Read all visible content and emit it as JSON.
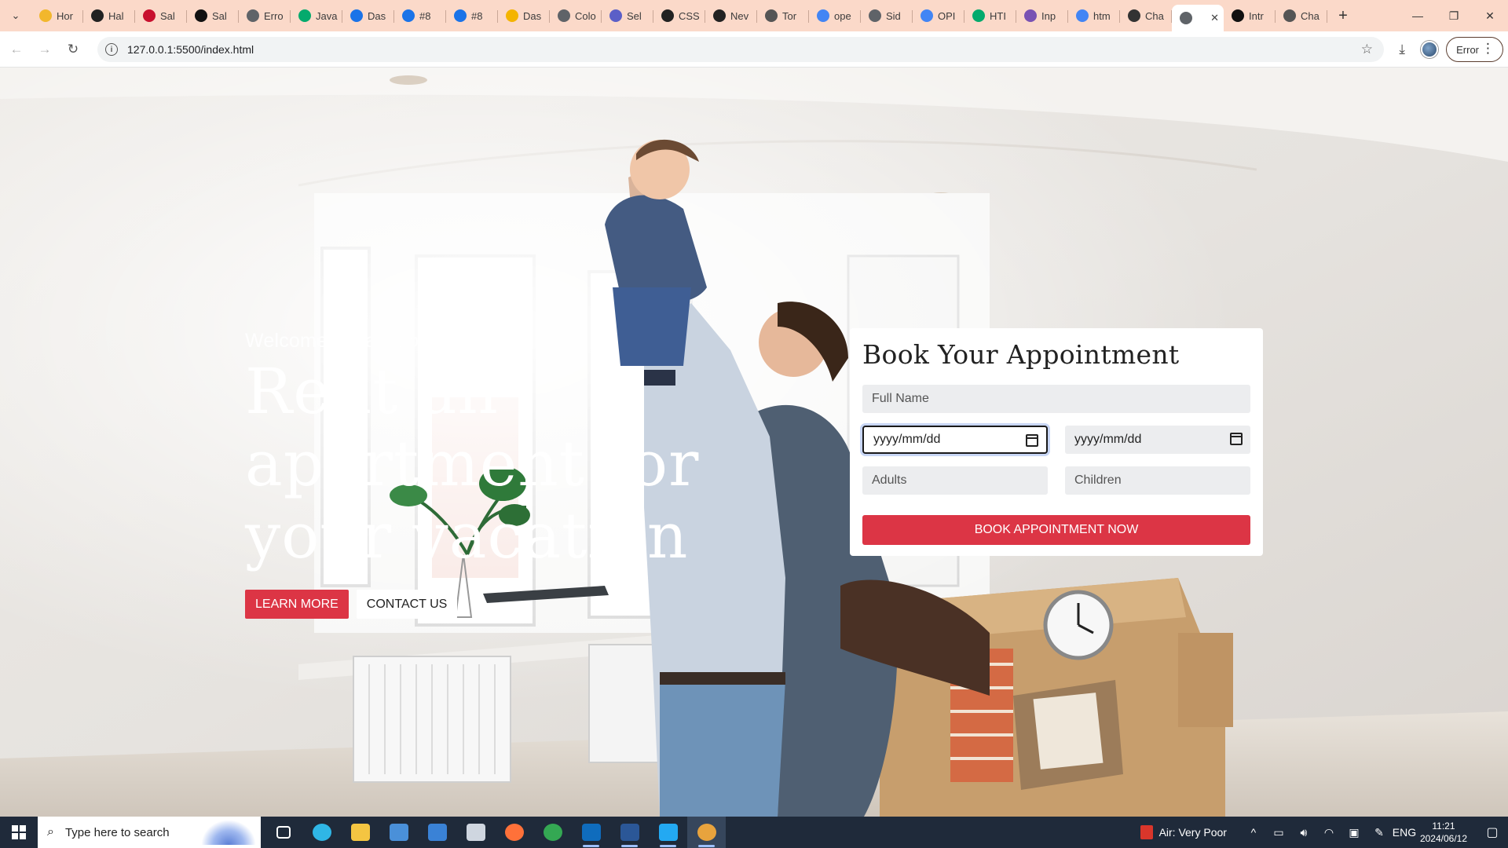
{
  "browser": {
    "tabs": [
      {
        "label": "Hor",
        "icon": "drive-icon",
        "color": "#f2b72c"
      },
      {
        "label": "Hal",
        "icon": "openai-icon",
        "color": "#222222"
      },
      {
        "label": "Sal",
        "icon": "sales-icon",
        "color": "#c8102e"
      },
      {
        "label": "Sal",
        "icon": "k-icon",
        "color": "#111111"
      },
      {
        "label": "Erro",
        "icon": "globe-icon",
        "color": "#5f6368"
      },
      {
        "label": "Java",
        "icon": "w3-icon",
        "color": "#04aa6d"
      },
      {
        "label": "Das",
        "icon": "bookmark-icon",
        "color": "#1a73e8"
      },
      {
        "label": "#8",
        "icon": "bookmark-icon",
        "color": "#1a73e8"
      },
      {
        "label": "#8",
        "icon": "bookmark-icon",
        "color": "#1a73e8"
      },
      {
        "label": "Das",
        "icon": "folder-icon",
        "color": "#f4b400"
      },
      {
        "label": "Colo",
        "icon": "globe-icon",
        "color": "#5f6368"
      },
      {
        "label": "Sel",
        "icon": "teams-icon",
        "color": "#5b5fc7"
      },
      {
        "label": "CSS",
        "icon": "github-icon",
        "color": "#222222"
      },
      {
        "label": "Nev",
        "icon": "openai-icon",
        "color": "#222222"
      },
      {
        "label": "Tor",
        "icon": "flame-icon",
        "color": "#555555"
      },
      {
        "label": "ope",
        "icon": "google-icon",
        "color": "#4285f4"
      },
      {
        "label": "Sid",
        "icon": "globe-icon",
        "color": "#5f6368"
      },
      {
        "label": "OPI",
        "icon": "google-icon",
        "color": "#4285f4"
      },
      {
        "label": "HTI",
        "icon": "w3-icon",
        "color": "#04aa6d"
      },
      {
        "label": "Inp",
        "icon": "bootstrap-icon",
        "color": "#7952b3"
      },
      {
        "label": "htm",
        "icon": "google-icon",
        "color": "#4285f4"
      },
      {
        "label": "Cha",
        "icon": "chatgpt-icon",
        "color": "#333333"
      },
      {
        "label": "",
        "icon": "globe-icon",
        "color": "#5f6368",
        "active": true
      },
      {
        "label": "Intr",
        "icon": "notion-icon",
        "color": "#111111"
      },
      {
        "label": "Cha",
        "icon": "openai-icon",
        "color": "#555555"
      }
    ],
    "url": "127.0.0.1:5500/index.html",
    "error_label": "Error"
  },
  "hero": {
    "welcome": "Welcome to vacation rental",
    "headline": "Rent an apartment for your vacation",
    "learn_more": "LEARN MORE",
    "contact_us": "CONTACT US"
  },
  "booking": {
    "title": "Book Your Appointment",
    "full_name_placeholder": "Full Name",
    "checkin_placeholder": "yyyy/mm/dd",
    "checkout_placeholder": "yyyy/mm/dd",
    "adults_placeholder": "Adults",
    "children_placeholder": "Children",
    "submit_label": "BOOK APPOINTMENT NOW",
    "accent_color": "#dc3545"
  },
  "taskbar": {
    "search_placeholder": "Type here to search",
    "apps": [
      {
        "icon": "task-view-icon",
        "color": "#ffffff"
      },
      {
        "icon": "edge-icon",
        "color": "#2fb6e6"
      },
      {
        "icon": "file-explorer-icon",
        "color": "#f4c542"
      },
      {
        "icon": "store-icon",
        "color": "#4a90d9"
      },
      {
        "icon": "mail-icon",
        "color": "#3a82d6"
      },
      {
        "icon": "settings-cube-icon",
        "color": "#cfd6e0"
      },
      {
        "icon": "firefox-icon",
        "color": "#ff7139"
      },
      {
        "icon": "chrome-icon",
        "color": "#34a853"
      },
      {
        "icon": "outlook-icon",
        "color": "#0f6cbd"
      },
      {
        "icon": "word-icon",
        "color": "#2b5797"
      },
      {
        "icon": "vscode-icon",
        "color": "#23a9f2"
      },
      {
        "icon": "chrome-canary-icon",
        "color": "#e8a33d"
      }
    ],
    "air_quality": "Air: Very Poor",
    "language": "ENG",
    "time": "11:21",
    "date": "2024/06/12"
  }
}
